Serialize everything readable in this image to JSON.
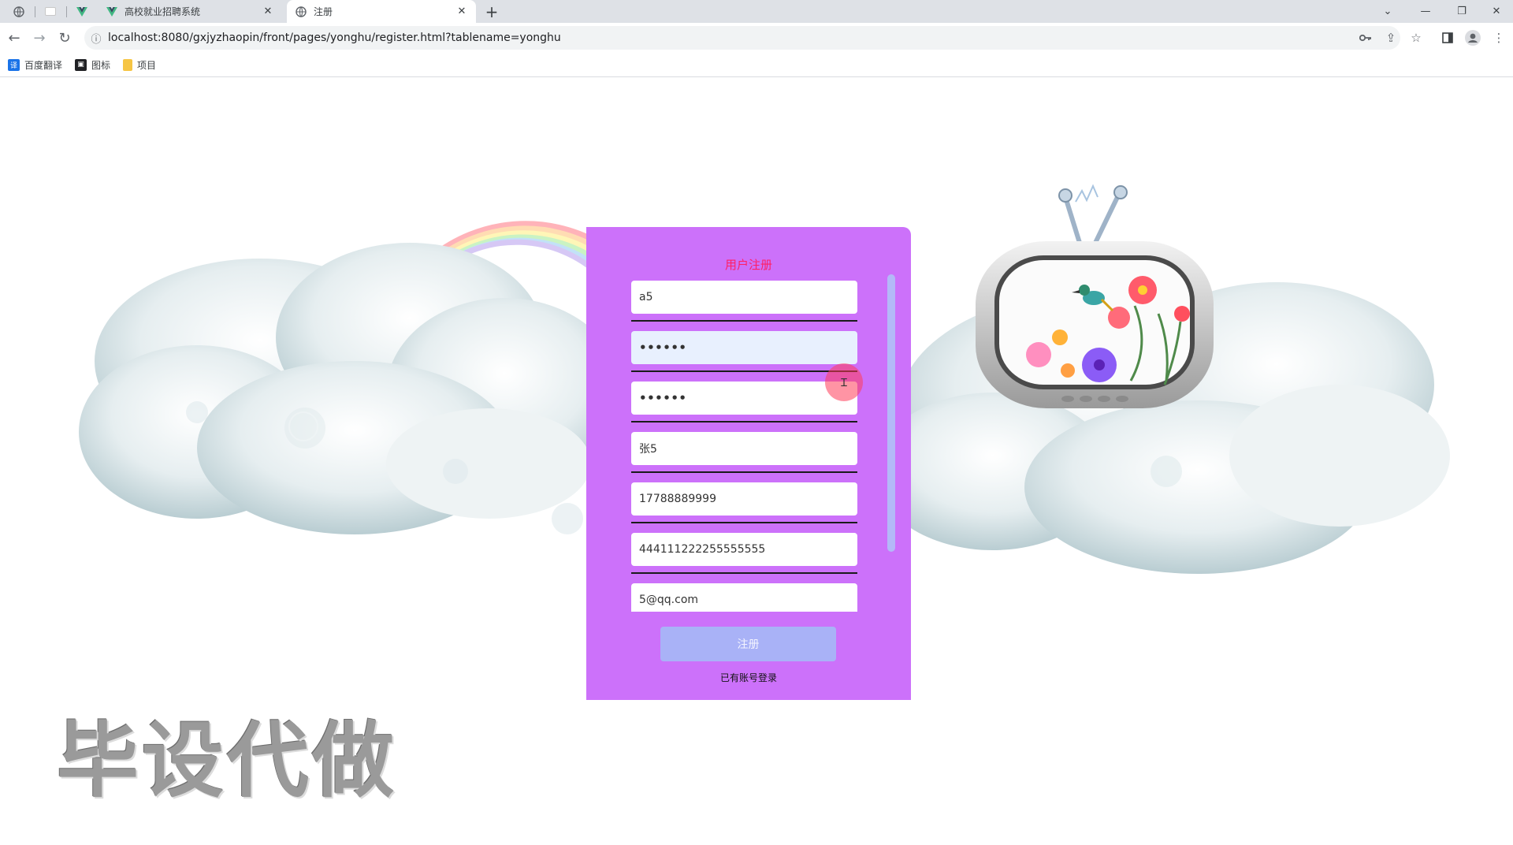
{
  "browser": {
    "tabs": [
      {
        "title": "高校就业招聘系统",
        "active": false
      },
      {
        "title": "注册",
        "active": true
      }
    ],
    "url": "localhost:8080/gxjyzhaopin/front/pages/yonghu/register.html?tablename=yonghu",
    "bookmarks": [
      {
        "label": "百度翻译",
        "icon": "translate-icon",
        "color": "#1a73e8"
      },
      {
        "label": "图标",
        "icon": "image-icon",
        "color": "#202124"
      },
      {
        "label": "项目",
        "icon": "folder-icon",
        "color": "#f6c544"
      }
    ]
  },
  "page": {
    "watermark": "毕设代做"
  },
  "register": {
    "title": "用户注册",
    "fields": [
      {
        "name": "username",
        "value": "a5"
      },
      {
        "name": "password",
        "value": "••••••"
      },
      {
        "name": "confirm-password",
        "value": "••••••"
      },
      {
        "name": "real-name",
        "value": "张5"
      },
      {
        "name": "phone",
        "value": "17788889999"
      },
      {
        "name": "id-card",
        "value": "444111222255555555"
      },
      {
        "name": "email",
        "value": "5@qq.com"
      }
    ],
    "submit_label": "注册",
    "login_link": "已有账号登录"
  },
  "colors": {
    "card": "#cc71fa",
    "title": "#ff1f64",
    "button": "#a9b2f7",
    "scrollbar": "#b4b8f8"
  }
}
